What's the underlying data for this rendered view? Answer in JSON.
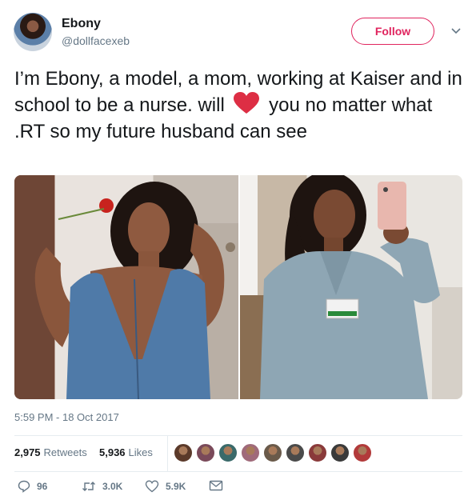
{
  "user": {
    "name": "Ebony",
    "handle": "@dollfacexeb",
    "follow_label": "Follow"
  },
  "tweet": {
    "text_before": "I’m Ebony, a model, a mom, working at Kaiser and in school to be a nurse. will",
    "text_after": "you no matter what .RT so my future husband can see",
    "emoji": "red-heart-icon",
    "timestamp": "5:59 PM - 18 Oct 2017"
  },
  "stats": {
    "retweets_count": "2,975",
    "retweets_label": "Retweets",
    "likes_count": "5,936",
    "likes_label": "Likes"
  },
  "likers": [
    "#5b3a2a",
    "#7a4a5a",
    "#3a6a6a",
    "#a06a7a",
    "#6a5a4a",
    "#4a4a4a",
    "#8a3a3a",
    "#3a3a3a",
    "#b23a3a"
  ],
  "actions": {
    "reply_count": "96",
    "retweet_count": "3.0K",
    "like_count": "5.9K"
  },
  "colors": {
    "accent": "#e0245e",
    "muted": "#657786",
    "heart": "#dd2e44"
  }
}
